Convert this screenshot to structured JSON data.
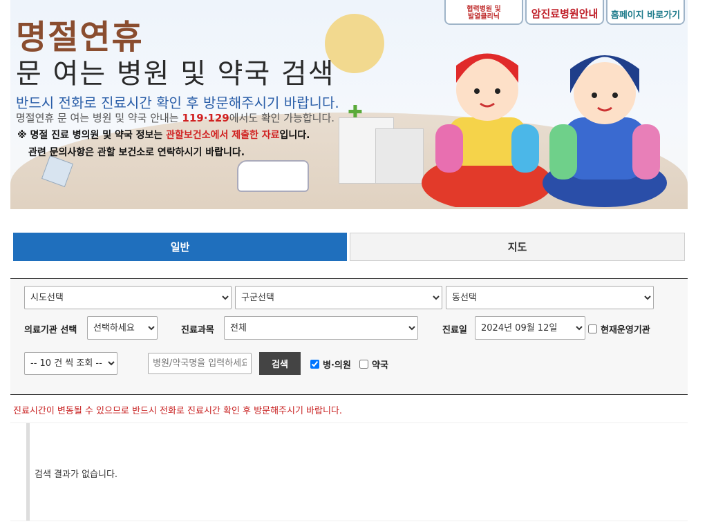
{
  "banner": {
    "title1": "명절연휴",
    "title2": "문 여는 병원 및 약국 검색",
    "line1": "반드시 전화로 진료시간 확인 후 방문해주시기 바랍니다.",
    "line2_pre": "명절연휴 문 여는 병원 및 약국 안내는 ",
    "line2_hl": "119·129",
    "line2_post": "에서도 확인 가능합니다.",
    "line3_pre": "※ 명절 진료 병의원 및 약국 정보는 ",
    "line3_hl": "관할보건소에서 제출한 자료",
    "line3_post": "입니다.",
    "line4": "관련 문의사항은 관할 보건소로 연락하시기 바랍니다.",
    "btn_partner": "협력병원 및\n발열클리닉",
    "btn_cancer": "암진료병원안내",
    "btn_home": "홈페이지 바로가기"
  },
  "tabs": [
    {
      "label": "일반",
      "active": true
    },
    {
      "label": "지도",
      "active": false
    }
  ],
  "search": {
    "sido": "시도선택",
    "gugun": "구군선택",
    "dong": "동선택",
    "inst_label": "의료기관 선택",
    "inst_value": "선택하세요",
    "dept_label": "진료과목",
    "dept_value": "전체",
    "date_label": "진료일",
    "date_value": "2024년 09월 12일",
    "current_label": "현재운영기관",
    "page_size": "-- 10 건 씩 조회 --",
    "keyword_placeholder": "병원/약국명을 입력하세요",
    "search_button": "검색",
    "hospital_label": "병·의원",
    "pharmacy_label": "약국"
  },
  "notice": "진료시간이 변동될 수 있으므로 반드시 전화로 진료시간 확인 후 방문해주시기 바랍니다.",
  "result_message": "검색 결과가 없습니다.",
  "colors": {
    "tab_active": "#1f6fbd",
    "notice_red": "#c82020",
    "search_button": "#444444"
  }
}
